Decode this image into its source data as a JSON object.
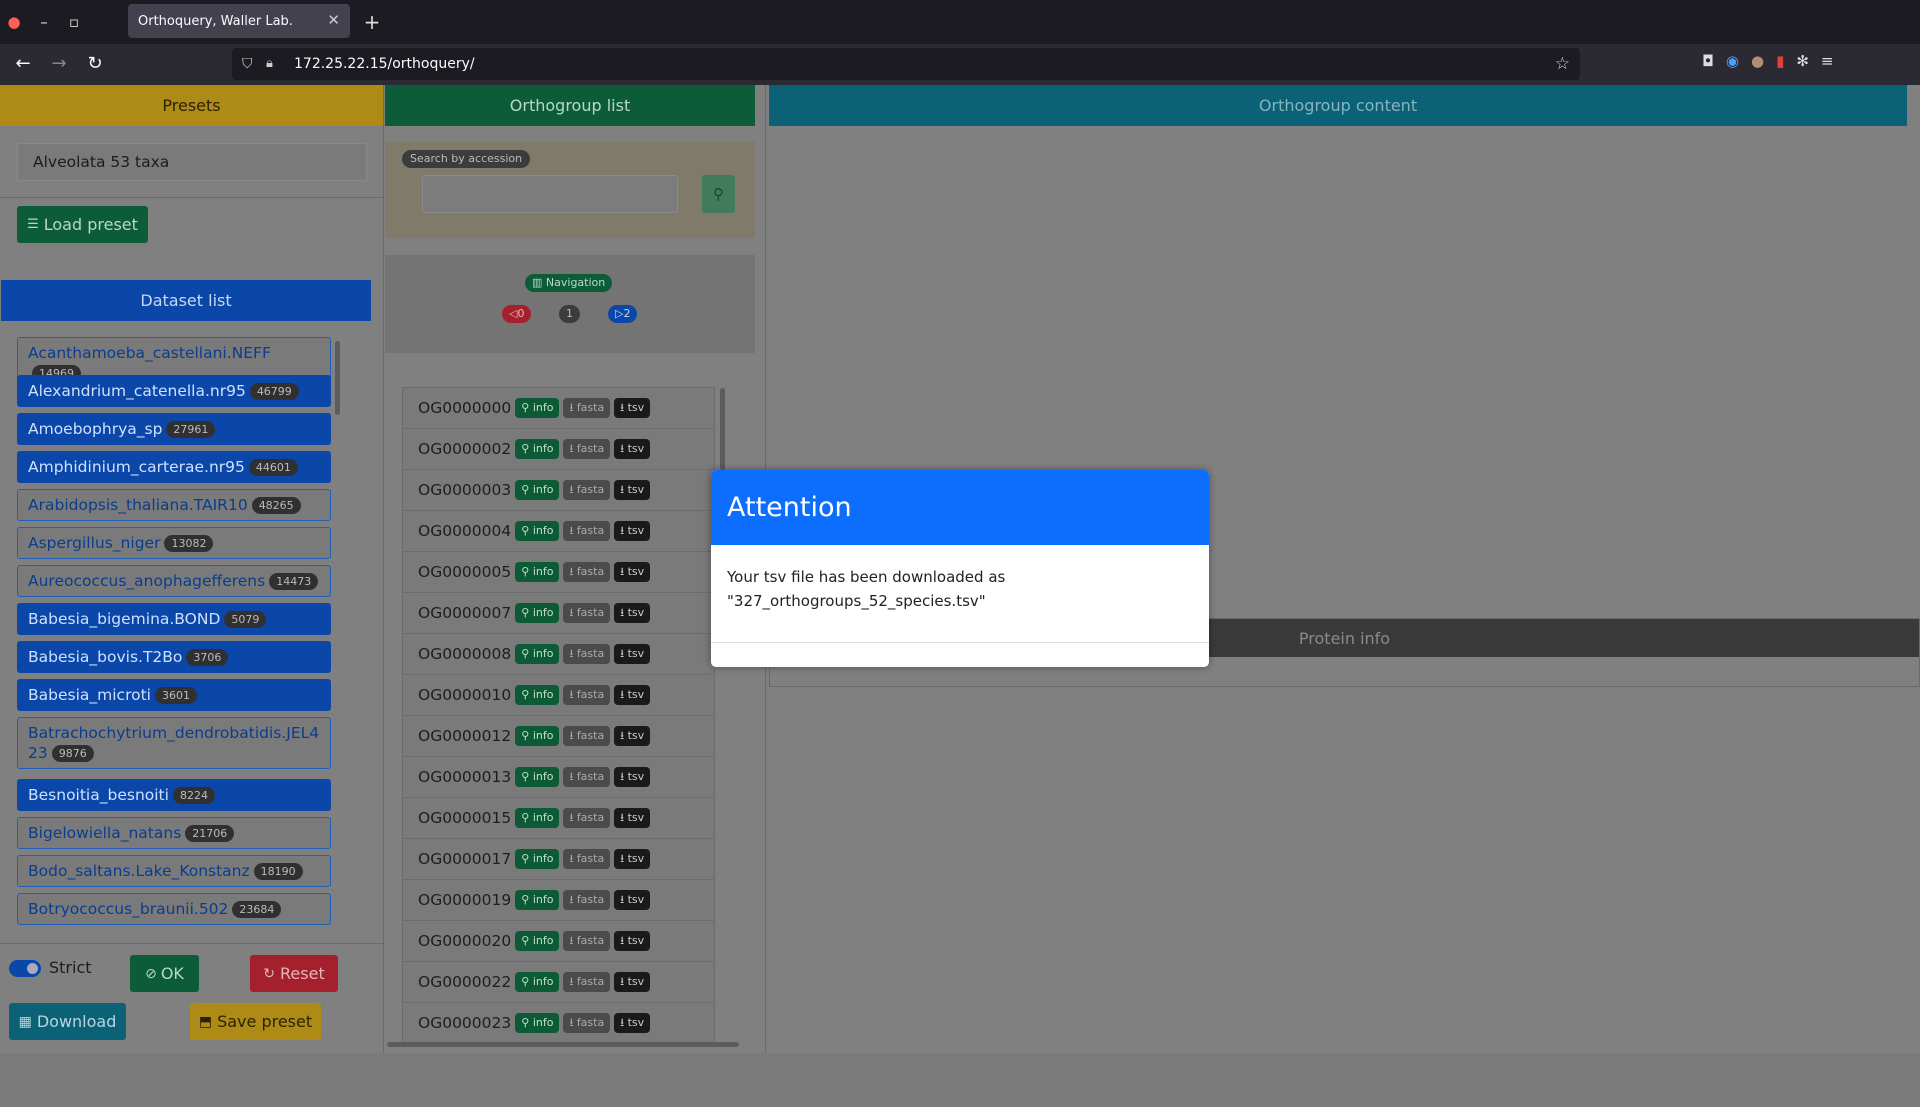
{
  "browser": {
    "tab_title": "Orthoquery, Waller Lab.",
    "url": "172.25.22.15/orthoquery/"
  },
  "presets": {
    "header": "Presets",
    "current": "Alveolata 53 taxa",
    "load_label": "Load preset"
  },
  "dataset_list": {
    "header": "Dataset list",
    "items": [
      {
        "name": "Acanthamoeba_castellani.NEFF",
        "count": "14969",
        "selected": false
      },
      {
        "name": "Alexandrium_catenella.nr95",
        "count": "46799",
        "selected": true
      },
      {
        "name": "Amoebophrya_sp",
        "count": "27961",
        "selected": true
      },
      {
        "name": "Amphidinium_carterae.nr95",
        "count": "44601",
        "selected": true
      },
      {
        "name": "Arabidopsis_thaliana.TAIR10",
        "count": "48265",
        "selected": false
      },
      {
        "name": "Aspergillus_niger",
        "count": "13082",
        "selected": false
      },
      {
        "name": "Aureococcus_anophagefferens",
        "count": "14473",
        "selected": false
      },
      {
        "name": "Babesia_bigemina.BOND",
        "count": "5079",
        "selected": true
      },
      {
        "name": "Babesia_bovis.T2Bo",
        "count": "3706",
        "selected": true
      },
      {
        "name": "Babesia_microti",
        "count": "3601",
        "selected": true
      },
      {
        "name": "Batrachochytrium_dendrobatidis.JEL423",
        "count": "9876",
        "selected": false
      },
      {
        "name": "Besnoitia_besnoiti",
        "count": "8224",
        "selected": true
      },
      {
        "name": "Bigelowiella_natans",
        "count": "21706",
        "selected": false
      },
      {
        "name": "Bodo_saltans.Lake_Konstanz",
        "count": "18190",
        "selected": false
      },
      {
        "name": "Botryococcus_braunii.502",
        "count": "23684",
        "selected": false
      }
    ]
  },
  "controls": {
    "strict_label": "Strict",
    "ok_label": "OK",
    "reset_label": "Reset",
    "download_label": "Download",
    "save_label": "Save preset"
  },
  "orthogroup_list": {
    "header": "Orthogroup list",
    "search_label": "Search by accession",
    "search_value": "",
    "nav_label": "Navigation",
    "nav_prev": "0",
    "nav_current": "1",
    "nav_next": "2",
    "btn_info": "info",
    "btn_fasta": "fasta",
    "btn_tsv": "tsv",
    "rows": [
      "OG0000000",
      "OG0000002",
      "OG0000003",
      "OG0000004",
      "OG0000005",
      "OG0000007",
      "OG0000008",
      "OG0000010",
      "OG0000012",
      "OG0000013",
      "OG0000015",
      "OG0000017",
      "OG0000019",
      "OG0000020",
      "OG0000022",
      "OG0000023"
    ]
  },
  "orthogroup_content": {
    "header": "Orthogroup content",
    "protein_info": "Protein info"
  },
  "modal": {
    "title": "Attention",
    "body_line1": "Your tsv file has been downloaded as",
    "body_line2": "\"327_orthogroups_52_species.tsv\""
  }
}
